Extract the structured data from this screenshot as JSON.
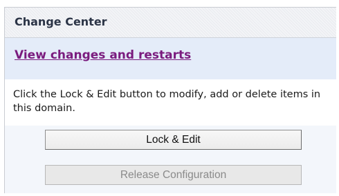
{
  "panel": {
    "title": "Change Center"
  },
  "changes": {
    "link_label": "View changes and restarts"
  },
  "info": {
    "text": "Click the Lock & Edit button to modify, add or delete items in this domain."
  },
  "buttons": {
    "lock_edit_label": "Lock & Edit",
    "release_label": "Release Configuration",
    "release_enabled": false
  },
  "colors": {
    "link": "#7a1b7e",
    "changes_bar_bg": "#e4ecf9",
    "panel_bg": "#f3f6fb"
  }
}
